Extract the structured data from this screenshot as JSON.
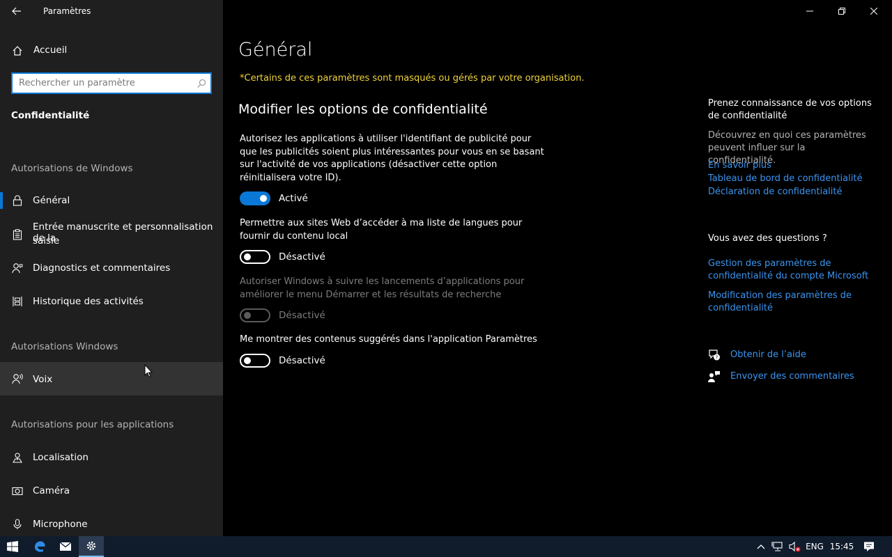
{
  "window": {
    "title": "Paramètres",
    "back_icon": "back-arrow-icon",
    "controls": [
      "minimize-icon",
      "restore-icon",
      "close-icon"
    ]
  },
  "sidebar": {
    "home_label": "Accueil",
    "search_placeholder": "Rechercher un paramètre",
    "category": "Confidentialité",
    "section1": "Autorisations de Windows",
    "items1": [
      {
        "label": "Général",
        "icon": "lock-icon",
        "selected": true
      },
      {
        "label_line1": "Entrée manuscrite et personnalisation de la",
        "label_line2": "saisie",
        "icon": "clipboard-icon"
      },
      {
        "label": "Diagnostics et commentaires",
        "icon": "person-feedback-icon"
      },
      {
        "label": "Historique des activités",
        "icon": "timeline-icon"
      }
    ],
    "section2": "Autorisations Windows",
    "items2": [
      {
        "label": "Voix",
        "icon": "speech-icon",
        "hovered": true
      }
    ],
    "section3": "Autorisations pour les applications",
    "items3": [
      {
        "label": "Localisation",
        "icon": "location-icon"
      },
      {
        "label": "Caméra",
        "icon": "camera-icon"
      },
      {
        "label": "Microphone",
        "icon": "microphone-icon"
      }
    ]
  },
  "main": {
    "title": "Général",
    "org_notice": "*Certains de ces paramètres sont masqués ou gérés par votre organisation.",
    "section_title": "Modifier les options de confidentialité",
    "settings": [
      {
        "description": "Autorisez les applications à utiliser l'identifiant de publicité pour que les publicités soient plus intéressantes pour vous en se basant sur l'activité de vos applications (désactiver cette option réinitialisera votre ID).",
        "state": "Activé",
        "on": true,
        "disabled": false
      },
      {
        "description": "Permettre aux sites Web d’accéder à ma liste de langues pour fournir du contenu local",
        "state": "Désactivé",
        "on": false,
        "disabled": false
      },
      {
        "description": "Autoriser Windows à suivre les lancements d’applications pour améliorer le menu Démarrer et les résultats de recherche",
        "state": "Désactivé",
        "on": false,
        "disabled": true
      },
      {
        "description": "Me montrer des contenus suggérés dans l'application Paramètres",
        "state": "Désactivé",
        "on": false,
        "disabled": false
      }
    ]
  },
  "right_panel": {
    "heading1": "Prenez connaissance de vos options de confidentialité",
    "text1": "Découvrez en quoi ces paramètres peuvent influer sur la confidentialité.",
    "links1": [
      "En savoir plus",
      "Tableau de bord de confidentialité",
      "Déclaration de confidentialité"
    ],
    "heading2": "Vous avez des questions ?",
    "links2": [
      "Gestion des paramètres de confidentialité du compte Microsoft",
      "Modification des paramètres de confidentialité"
    ],
    "help_label": "Obtenir de l’aide",
    "feedback_label": "Envoyer des commentaires"
  },
  "taskbar": {
    "language": "ENG",
    "time": "15:45",
    "icons": [
      "windows-start-icon",
      "edge-icon",
      "mail-icon",
      "settings-icon",
      "chevron-up-icon",
      "network-icon",
      "volume-muted-icon",
      "notifications-icon"
    ]
  },
  "colors": {
    "accent": "#0a78d7",
    "link": "#3b95f0",
    "notice": "#f0d33a",
    "sidebar_bg": "#1f1f1f",
    "taskbar_bg": "#101c2c"
  }
}
